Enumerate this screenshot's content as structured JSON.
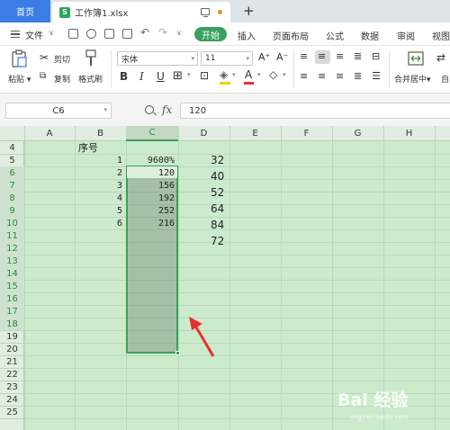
{
  "tabs": {
    "home": "首页",
    "file": "工作簿1.xlsx",
    "file_icon": "S"
  },
  "menu": {
    "file": "文件",
    "start": "开始",
    "items": [
      "插入",
      "页面布局",
      "公式",
      "数据",
      "审阅",
      "视图"
    ]
  },
  "ribbon": {
    "paste": "粘贴",
    "cut": "剪切",
    "copy": "复制",
    "format_painter": "格式刷",
    "font_name": "宋体",
    "font_size": "11",
    "bold": "B",
    "italic": "I",
    "underline": "U",
    "merge_center": "合并居中",
    "auto": "自"
  },
  "formula_bar": {
    "name_box": "C6",
    "fx": "fx",
    "formula": "120"
  },
  "grid": {
    "columns": [
      "A",
      "B",
      "C",
      "D",
      "E",
      "F",
      "G",
      "H"
    ],
    "rows": [
      "4",
      "5",
      "6",
      "7",
      "8",
      "9",
      "10",
      "11",
      "12",
      "13",
      "14",
      "15",
      "16",
      "17",
      "18",
      "19",
      "20",
      "21",
      "22",
      "23",
      "24",
      "25"
    ],
    "selected_column": "C",
    "selected_rows": [
      "6",
      "7",
      "8",
      "9",
      "10",
      "11",
      "12",
      "13",
      "14",
      "15",
      "16",
      "17",
      "18"
    ],
    "header_b4": "序号",
    "colB": [
      "1",
      "2",
      "3",
      "4",
      "5",
      "6"
    ],
    "colC": [
      "9600%",
      "120",
      "156",
      "192",
      "252",
      "216"
    ],
    "colD": [
      "32",
      "40",
      "52",
      "64",
      "84",
      "72"
    ]
  },
  "watermark": {
    "text": "Bai 经验",
    "url": "jingyan.baidu.com"
  },
  "colors": {
    "accent_green": "#3aa05e",
    "home_tab_blue": "#3b7ce5",
    "arrow_red": "#e8312f",
    "sheet_bg": "#ccebcc"
  }
}
